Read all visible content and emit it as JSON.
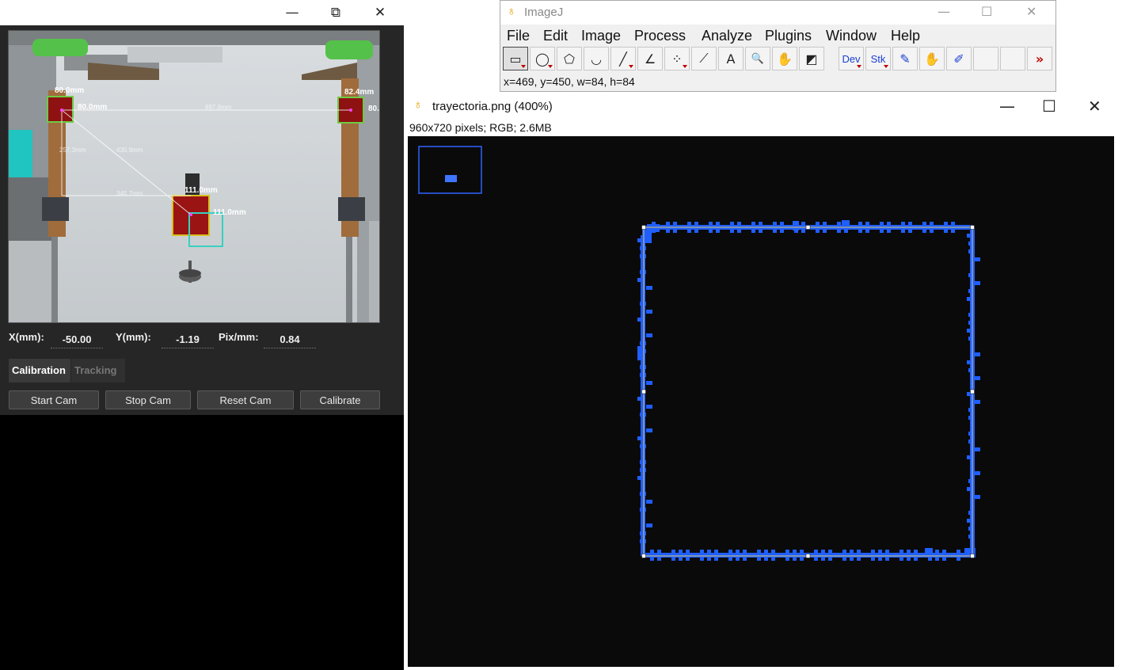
{
  "tracking_app": {
    "window_controls": {
      "minimize": "—",
      "restore": "⧉",
      "close": "✕"
    },
    "camera": {
      "markers": [
        {
          "label": "80.0mm",
          "sublabel": "80.0mm"
        },
        {
          "label": "82.4mm",
          "sublabel": "80."
        },
        {
          "label": "111.0mm",
          "sublabel": "111.0mm"
        }
      ],
      "distances": [
        "897.9mm",
        "257.3mm",
        "430.9mm",
        "345.7mm"
      ]
    },
    "coordinates": {
      "x_label": "X(mm):",
      "x_value": "-50.00",
      "y_label": "Y(mm):",
      "y_value": "-1.19",
      "pix_label": "Pix/mm:",
      "pix_value": "0.84"
    },
    "tabs": [
      {
        "label": "Calibration",
        "active": true
      },
      {
        "label": "Tracking",
        "active": false
      }
    ],
    "buttons": [
      "Start Cam",
      "Stop Cam",
      "Reset Cam",
      "Calibrate"
    ]
  },
  "imagej": {
    "title": "ImageJ",
    "window_controls": {
      "minimize": "—",
      "maximize": "☐",
      "close": "✕"
    },
    "menu": [
      "File",
      "Edit",
      "Image",
      "Process",
      "Analyze",
      "Plugins",
      "Window",
      "Help"
    ],
    "tools": [
      {
        "icon": "rectangle-tool-icon",
        "glyph": "▭",
        "selected": true,
        "submenu": true
      },
      {
        "icon": "oval-tool-icon",
        "glyph": "◯",
        "submenu": true
      },
      {
        "icon": "polygon-tool-icon",
        "glyph": "⬠"
      },
      {
        "icon": "freehand-tool-icon",
        "glyph": "◡"
      },
      {
        "icon": "line-tool-icon",
        "glyph": "╱",
        "submenu": true
      },
      {
        "icon": "angle-tool-icon",
        "glyph": "∠"
      },
      {
        "icon": "multipoint-tool-icon",
        "glyph": "⁘",
        "submenu": true
      },
      {
        "icon": "wand-tool-icon",
        "glyph": "⟋"
      },
      {
        "icon": "text-tool-icon",
        "glyph": "A"
      },
      {
        "icon": "magnifier-tool-icon",
        "glyph": "🔍"
      },
      {
        "icon": "hand-tool-icon",
        "glyph": "✋"
      },
      {
        "icon": "color-picker-tool-icon",
        "glyph": "◩"
      },
      {
        "icon": "dev-menu-icon",
        "glyph": "Dev",
        "submenu": true
      },
      {
        "icon": "stk-menu-icon",
        "glyph": "Stk",
        "submenu": true
      },
      {
        "icon": "brush-tool-icon",
        "glyph": "✎"
      },
      {
        "icon": "flood-fill-tool-icon",
        "glyph": "✋"
      },
      {
        "icon": "pencil-tool-icon",
        "glyph": "✐"
      },
      {
        "icon": "empty-slot-icon",
        "glyph": ""
      },
      {
        "icon": "empty-slot-icon",
        "glyph": ""
      },
      {
        "icon": "more-tools-icon",
        "glyph": "»"
      }
    ],
    "status": "x=469, y=450, w=84, h=84"
  },
  "image_window": {
    "title": "trayectoria.png (400%)",
    "info": "960x720 pixels; RGB; 2.6MB",
    "window_controls": {
      "minimize": "—",
      "maximize": "☐",
      "close": "✕"
    },
    "colors": {
      "trajectory": "#1f5eff",
      "roi": "#d8c860",
      "background": "#0a0a0a"
    }
  }
}
